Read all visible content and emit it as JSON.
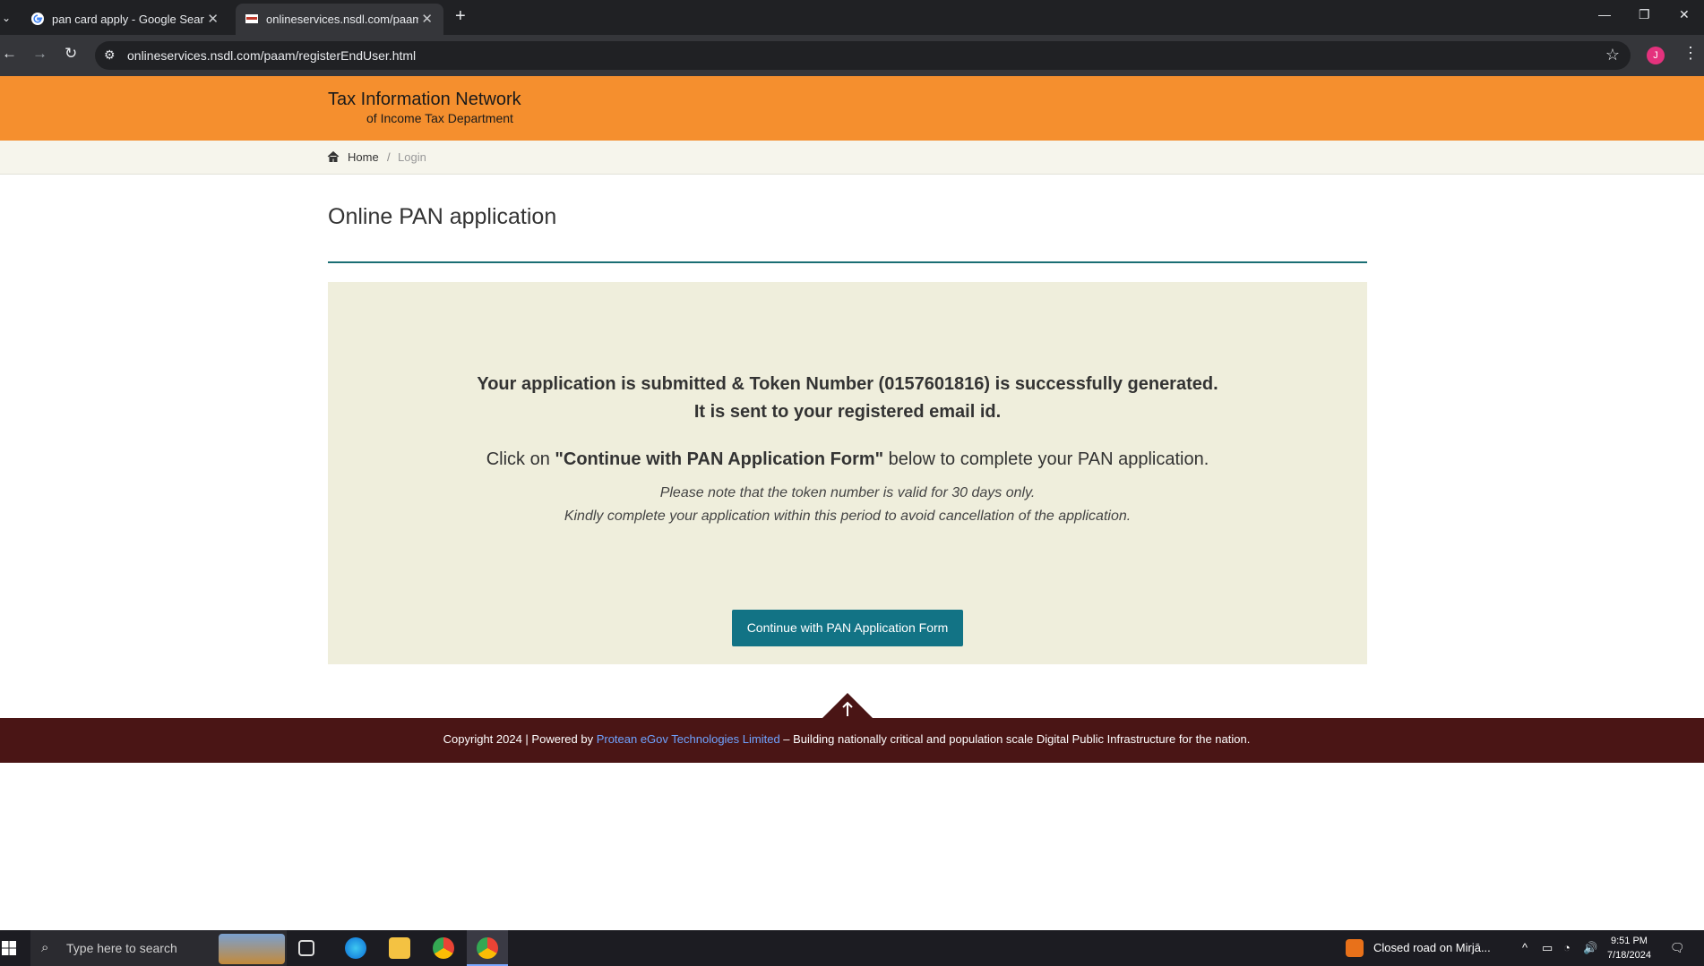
{
  "browser": {
    "tabs": [
      {
        "title": "pan card apply - Google Search",
        "active": false
      },
      {
        "title": "onlineservices.nsdl.com/paam/r",
        "active": true
      }
    ],
    "new_tab_icon": "plus-icon",
    "url": "onlineservices.nsdl.com/paam/registerEndUser.html",
    "profile_initial": "J",
    "window_controls": [
      "minimize-icon",
      "restore-icon",
      "close-icon"
    ]
  },
  "site": {
    "brand_line1": "Tax Information Network",
    "brand_line2": "of Income Tax Department",
    "colors": {
      "header": "#f58f2e",
      "accent": "#127385",
      "footer": "#4a1515",
      "panel": "#efeedc"
    }
  },
  "breadcrumb": {
    "home": "Home",
    "separator": "/",
    "current": "Login"
  },
  "main": {
    "page_title": "Online PAN application",
    "message_line1": "Your application is submitted & Token Number (0157601816) is successfully generated.",
    "message_line2": "It is sent to your registered email id.",
    "instruction_prefix": "Click on ",
    "instruction_bold": "\"Continue with PAN Application Form\"",
    "instruction_suffix": " below to complete your PAN application.",
    "note1": "Please note that the token number is valid for 30 days only.",
    "note2": "Kindly complete your application within this period to avoid cancellation of the application.",
    "continue_button": "Continue with PAN Application Form"
  },
  "footer": {
    "prefix": "Copyright 2024 | Powered by ",
    "link": "Protean eGov Technologies Limited",
    "suffix": " – Building nationally critical and population scale Digital Public Infrastructure for the nation."
  },
  "taskbar": {
    "search_placeholder": "Type here to search",
    "notification": "Closed road on Mirjā...",
    "time": "9:51 PM",
    "date": "7/18/2024"
  }
}
